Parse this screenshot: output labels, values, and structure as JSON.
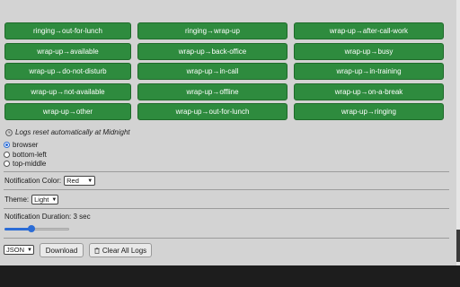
{
  "transitions": [
    "ringing→out-for-lunch",
    "ringing→wrap-up",
    "wrap-up→after-call-work",
    "wrap-up→available",
    "wrap-up→back-office",
    "wrap-up→busy",
    "wrap-up→do-not-disturb",
    "wrap-up→in-call",
    "wrap-up→in-training",
    "wrap-up→not-available",
    "wrap-up→offline",
    "wrap-up→on-a-break",
    "wrap-up→other",
    "wrap-up→out-for-lunch",
    "wrap-up→ringing"
  ],
  "logs_note": "Logs reset automatically at Midnight",
  "position_options": [
    "browser",
    "bottom-left",
    "top-middle"
  ],
  "selected_position": "browser",
  "notification_color": {
    "label": "Notification Color:",
    "value": "Red"
  },
  "theme": {
    "label": "Theme:",
    "value": "Light"
  },
  "duration": {
    "label": "Notification Duration: 3 sec",
    "level": 0.4
  },
  "export_format": "JSON",
  "download_label": "Download",
  "clear_label": "Clear All Logs",
  "colors": {
    "button_green": "#2e8b3e",
    "accent": "#2b6cd6"
  }
}
